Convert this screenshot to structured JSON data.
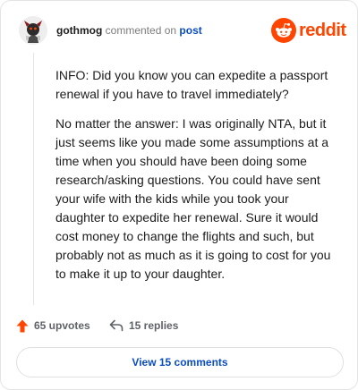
{
  "comment": {
    "username": "gothmog",
    "verb": "commented on",
    "context_link": "post",
    "paragraphs": [
      "INFO: Did you know you can expedite a passport renewal if you have to travel immediately?",
      "No matter the answer: I was originally NTA, but it just seems like you made some assumptions at a time when you should have been doing some research/asking questions. You could have sent your wife with the kids while you took your daughter to expedite her renewal. Sure it would cost money to change the flights and such, but probably not as much as it is going to cost for you to make it up to your daughter."
    ]
  },
  "brand": {
    "wordmark": "reddit",
    "color": "#ff4500",
    "icon": "reddit-snoo-icon"
  },
  "actions": {
    "upvotes_label": "65 upvotes",
    "upvote_icon": "arrow-up-icon",
    "upvote_color": "#ff4500",
    "replies_label": "15 replies",
    "reply_icon": "reply-arrow-icon"
  },
  "view_button": {
    "label": "View 15 comments",
    "color": "#0a4cc2"
  }
}
